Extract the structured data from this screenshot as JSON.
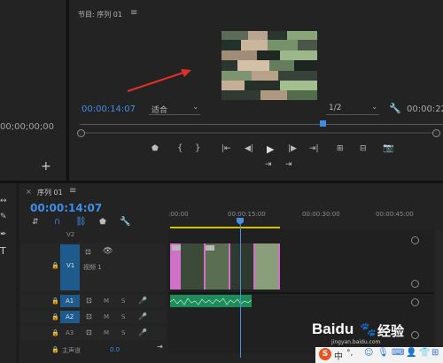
{
  "source_panel": {
    "timecode": "00;00;00;00"
  },
  "program_monitor": {
    "title": "节目: 序列 01",
    "menu_glyph": "≡",
    "current_time": "00:00:14:07",
    "fit_select": "适合",
    "resolution_select": "1/2",
    "duration": "00:00:22"
  },
  "tools": {
    "type_tool": "T"
  },
  "sequence": {
    "tab_close": "×",
    "tab_label": "序列 01",
    "menu_glyph": "≡",
    "current_time": "00:00:14:07",
    "ruler_labels": [
      ":00:00",
      "00:00:15:00",
      "00:00:30:00",
      "00:00:45:00"
    ],
    "tracks": {
      "v2": "V2",
      "v1": "V1",
      "v1_name": "视频 1",
      "a1": "A1",
      "a2": "A2",
      "a3": "A3",
      "m": "M",
      "s": "S",
      "master_label": "主声道",
      "master_value": "0.0"
    }
  },
  "watermark": {
    "brand": "Baidu",
    "suffix": "经验",
    "url": "jingyan.baidu.com"
  },
  "taskbar": {
    "ime_label": "中",
    "ime_punct": "°,"
  },
  "colors": {
    "accent_blue": "#3d8ee8",
    "playhead": "#4a90e2",
    "clip_pink": "#d070c8",
    "audio_green": "#1f8a5a",
    "work_area": "#d4c400",
    "annotation_arrow": "#e0302a"
  }
}
